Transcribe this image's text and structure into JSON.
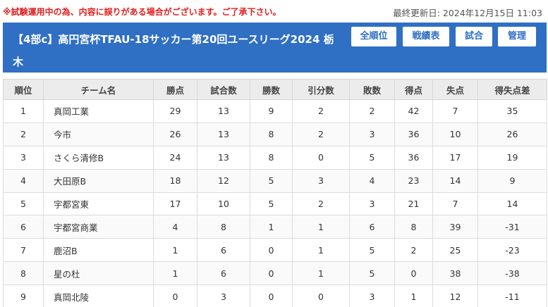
{
  "notice": "※試験運用中の為、内容に誤りがある場合がございます。ご了承下さい。",
  "updated": "最終更新日: 2024年12月15日 11:03",
  "header": {
    "title": "【4部c】高円宮杯TFAU-18サッカー第20回ユースリーグ2024 栃木"
  },
  "nav": {
    "all_ranking": "全順位",
    "records": "戦績表",
    "matches": "試合",
    "admin": "管理"
  },
  "table": {
    "columns": [
      "順位",
      "チーム名",
      "勝点",
      "試合数",
      "勝数",
      "引分数",
      "敗数",
      "得点",
      "失点",
      "得失点差"
    ],
    "rows": [
      [
        "1",
        "真岡工業",
        "29",
        "13",
        "9",
        "2",
        "2",
        "42",
        "7",
        "35"
      ],
      [
        "2",
        "今市",
        "26",
        "13",
        "8",
        "2",
        "3",
        "36",
        "10",
        "26"
      ],
      [
        "3",
        "さくら清修B",
        "24",
        "13",
        "8",
        "0",
        "5",
        "36",
        "17",
        "19"
      ],
      [
        "4",
        "大田原B",
        "18",
        "12",
        "5",
        "3",
        "4",
        "23",
        "14",
        "9"
      ],
      [
        "5",
        "宇都宮東",
        "17",
        "10",
        "5",
        "2",
        "3",
        "21",
        "7",
        "14"
      ],
      [
        "6",
        "宇都宮商業",
        "4",
        "8",
        "1",
        "1",
        "6",
        "8",
        "39",
        "-31"
      ],
      [
        "7",
        "鹿沼B",
        "1",
        "6",
        "0",
        "1",
        "5",
        "2",
        "25",
        "-23"
      ],
      [
        "8",
        "星の杜",
        "1",
        "6",
        "0",
        "1",
        "5",
        "0",
        "38",
        "-38"
      ],
      [
        "9",
        "真岡北陵",
        "0",
        "3",
        "0",
        "0",
        "3",
        "1",
        "12",
        "-11"
      ]
    ]
  }
}
